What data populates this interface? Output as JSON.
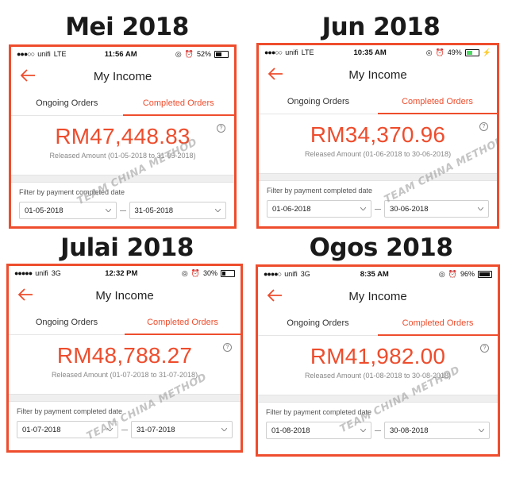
{
  "app": {
    "title": "My Income",
    "tabs": [
      "Ongoing Orders",
      "Completed Orders"
    ],
    "filter_label": "Filter by payment completed date",
    "watermark": "TEAM CHINA METHOD",
    "accent_color": "#ee4d2d"
  },
  "panels": [
    {
      "label": "Mei 2018",
      "status": {
        "carrier": "unifi",
        "network": "LTE",
        "time": "11:56 AM",
        "battery": "52%"
      },
      "battery_level": 0.52,
      "battery_charging": false,
      "amount": "RM47,448.83",
      "released": "Released Amount (01-05-2018 to 31-05-2018)",
      "from": "01-05-2018",
      "to": "31-05-2018"
    },
    {
      "label": "Jun 2018",
      "status": {
        "carrier": "unifi",
        "network": "LTE",
        "time": "10:35 AM",
        "battery": "49%"
      },
      "battery_level": 0.49,
      "battery_charging": true,
      "amount": "RM34,370.96",
      "released": "Released Amount (01-06-2018 to 30-06-2018)",
      "from": "01-06-2018",
      "to": "30-06-2018"
    },
    {
      "label": "Julai 2018",
      "status": {
        "carrier": "unifi",
        "network": "3G",
        "time": "12:32 PM",
        "battery": "30%"
      },
      "battery_level": 0.3,
      "battery_charging": false,
      "amount": "RM48,788.27",
      "released": "Released Amount (01-07-2018 to 31-07-2018)",
      "from": "01-07-2018",
      "to": "31-07-2018"
    },
    {
      "label": "Ogos 2018",
      "status": {
        "carrier": "unifi",
        "network": "3G",
        "time": "8:35 AM",
        "battery": "96%"
      },
      "battery_level": 0.96,
      "battery_charging": false,
      "amount": "RM41,982.00",
      "released": "Released Amount (01-08-2018 to 30-08-2018)",
      "from": "01-08-2018",
      "to": "30-08-2018"
    }
  ]
}
